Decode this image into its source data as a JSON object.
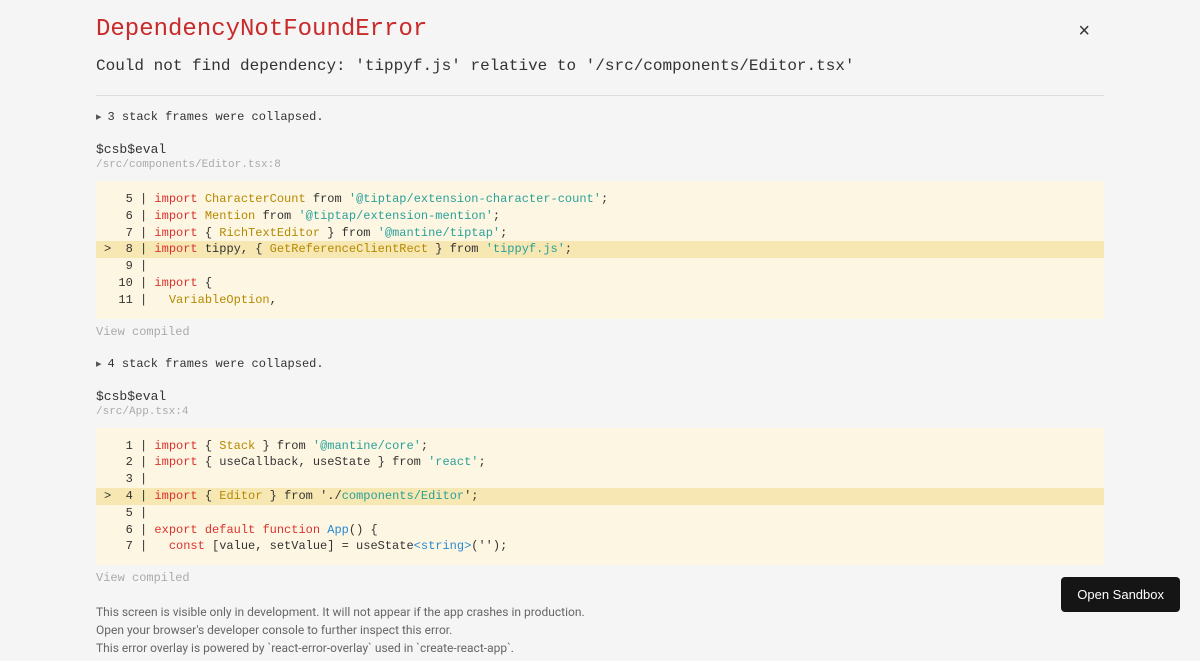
{
  "error": {
    "title": "DependencyNotFoundError",
    "message": "Could not find dependency: 'tippyf.js' relative to '/src/components/Editor.tsx'"
  },
  "close_label": "×",
  "frames": {
    "collapsed1": "3 stack frames were collapsed.",
    "frame1": {
      "name": "$csb$eval",
      "location": "/src/components/Editor.tsx:8",
      "view_compiled": "View compiled"
    },
    "collapsed2": "4 stack frames were collapsed.",
    "frame2": {
      "name": "$csb$eval",
      "location": "/src/App.tsx:4",
      "view_compiled": "View compiled"
    }
  },
  "code1": {
    "l5_num": "   5 | ",
    "l5_kw": "import",
    "l5_name": " CharacterCount",
    "l5_from": " from ",
    "l5_str": "'@tiptap/extension-character-count'",
    "l5_end": ";",
    "l6_num": "   6 | ",
    "l6_kw": "import",
    "l6_name": " Mention",
    "l6_from": " from ",
    "l6_str": "'@tiptap/extension-mention'",
    "l6_end": ";",
    "l7_num": "   7 | ",
    "l7_kw": "import",
    "l7_lb": " { ",
    "l7_name": "RichTextEditor",
    "l7_rb": " } from ",
    "l7_str": "'@mantine/tiptap'",
    "l7_end": ";",
    "l8_num": ">  8 | ",
    "l8_kw": "import",
    "l8_t": " tippy, { ",
    "l8_name": "GetReferenceClientRect",
    "l8_rb": " } from ",
    "l8_str": "'tippyf.js'",
    "l8_end": ";",
    "l9_num": "   9 | ",
    "l10_num": "  10 | ",
    "l10_kw": "import",
    "l10_lb": " {",
    "l11_num": "  11 |   ",
    "l11_name": "VariableOption",
    "l11_end": ","
  },
  "code2": {
    "l1_num": "   1 | ",
    "l1_kw": "import",
    "l1_lb": " { ",
    "l1_name": "Stack",
    "l1_rb": " } from ",
    "l1_str": "'@mantine/core'",
    "l1_end": ";",
    "l2_num": "   2 | ",
    "l2_kw": "import",
    "l2_lb": " { useCallback, useState } from ",
    "l2_str": "'react'",
    "l2_end": ";",
    "l3_num": "   3 | ",
    "l4_num": ">  4 | ",
    "l4_kw": "import",
    "l4_lb": " { ",
    "l4_name": "Editor",
    "l4_rb": " } from ",
    "l4_sq": "'./",
    "l4_str": "components/Editor",
    "l4_end": "';",
    "l5_num": "   5 | ",
    "l6_num": "   6 | ",
    "l6_kw1": "export",
    "l6_kw2": " default ",
    "l6_kw3": "function",
    "l6_name": " App",
    "l6_end": "() {",
    "l7_num": "   7 |   ",
    "l7_kw": "const",
    "l7_mid": " [value, setValue] = useState",
    "l7_type": "<string>",
    "l7_end": "('');"
  },
  "footer": {
    "line1": "This screen is visible only in development. It will not appear if the app crashes in production.",
    "line2": "Open your browser's developer console to further inspect this error.",
    "line3": "This error overlay is powered by `react-error-overlay` used in `create-react-app`."
  },
  "sandbox_label": "Open Sandbox"
}
